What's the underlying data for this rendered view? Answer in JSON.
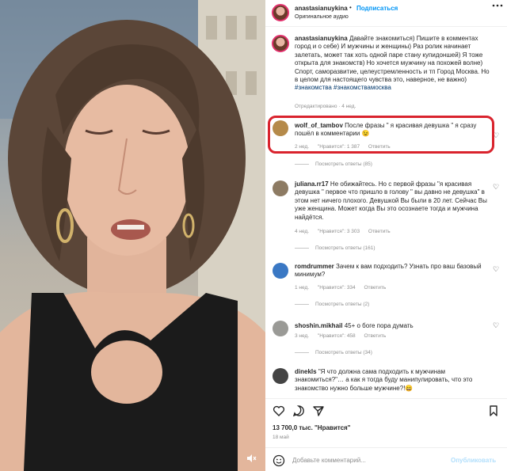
{
  "header": {
    "username": "anastasianuykina",
    "separator": "•",
    "follow_label": "Подписаться",
    "audio_label": "Оригинальное аудио",
    "more_icon": "more-horizontal-icon"
  },
  "caption": {
    "username": "anastasianuykina",
    "text": "Давайте знакомиться) Пишите в комментах город и о себе) И мужчины и женщины) Раз ролик начинает залетать, может так хоть одной паре стану купидоншей) Я тоже открыта для знакомств) Но хочется мужчину на похожей волне) Спорт, саморазвитие, целеустремленность и тп Город Москва. Но в целом для настоящего чувства это, наверное, не важно)",
    "tags": "#знакомства #знакомствамосква",
    "edited": "Отредактировано · 4 нед."
  },
  "comments": [
    {
      "username": "wolf_of_tambov",
      "text": "После фразы \" я красивая девушка \" я сразу пошёл в комментарии 😉",
      "age": "2 нед.",
      "likes": "\"Нравится\": 1 387",
      "reply": "Ответить",
      "replies": "Посмотреть ответы (85)",
      "avatar_color": "#b58a4a"
    },
    {
      "username": "juliana.rr17",
      "text": "Не обижайтесь. Но с первой фразы \"я красивая девушка \" первое что пришло в голову \" вы давно не девушка\" в этом нет ничего плохого. Девушкой Вы были в 20 лет. Сейчас Вы уже женщина. Может когда Вы это осознаете тогда и мужчина найдётся.",
      "age": "4 нед.",
      "likes": "\"Нравится\": 3 303",
      "reply": "Ответить",
      "replies": "Посмотреть ответы (161)",
      "avatar_color": "#8d7b63"
    },
    {
      "username": "romdrummer",
      "text": "Зачем к вам подходить? Узнать про ваш базовый минимум?",
      "age": "1 нед.",
      "likes": "\"Нравится\": 334",
      "reply": "Ответить",
      "replies": "Посмотреть ответы (2)",
      "avatar_color": "#3a78c4"
    },
    {
      "username": "shoshin.mikhail",
      "text": "45+ о боге пора думать",
      "age": "3 нед.",
      "likes": "\"Нравится\": 458",
      "reply": "Ответить",
      "replies": "Посмотреть ответы (34)",
      "avatar_color": "#9a9a96"
    },
    {
      "username": "dinekls",
      "text": "\"Я что должна сама подходить к мужчинам знакомиться?\"… а как я тогда буду манипулировать, что это знакомство нужно больше мужчине?!😄",
      "avatar_color": "#444444"
    }
  ],
  "actions": {
    "like_icon": "heart-icon",
    "comment_icon": "comment-icon",
    "share_icon": "share-icon",
    "save_icon": "bookmark-icon"
  },
  "likes_text": "13 700,0 тыс. \"Нравится\"",
  "date": "18 май",
  "add_comment": {
    "placeholder": "Добавьте комментарий...",
    "post_label": "Опубликовать"
  },
  "media": {
    "mute_icon": "volume-off-icon"
  }
}
